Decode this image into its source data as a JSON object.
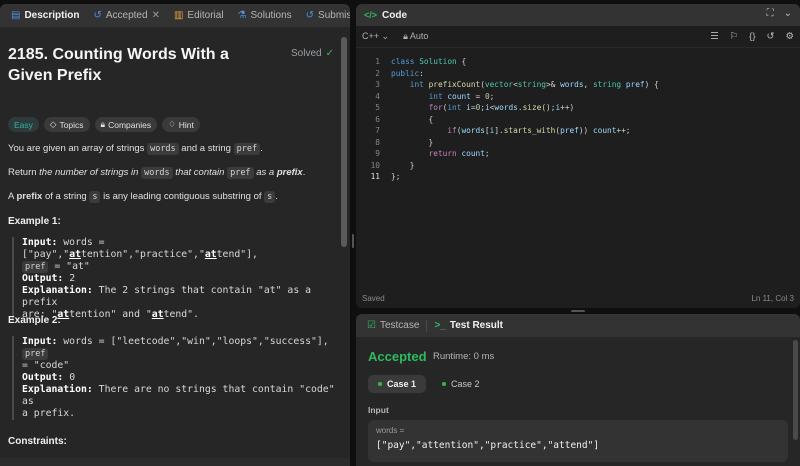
{
  "left_tabs": [
    {
      "label": "Description",
      "icon": "document-icon"
    },
    {
      "label": "Accepted",
      "icon": "history-icon"
    },
    {
      "label": "Editorial",
      "icon": "book-icon"
    },
    {
      "label": "Solutions",
      "icon": "flask-icon"
    },
    {
      "label": "Submissions",
      "icon": "history-icon"
    }
  ],
  "problem": {
    "title": "2185. Counting Words With a Given Prefix",
    "solved_label": "Solved",
    "tags": [
      "Easy",
      "Topics",
      "Companies",
      "Hint"
    ],
    "p1_a": "You are given an array of strings ",
    "p1_code1": "words",
    "p1_b": " and a string ",
    "p1_code2": "pref",
    "p1_c": ".",
    "p2_a": "Return ",
    "p2_it1": "the number of strings in ",
    "p2_code1": "words",
    "p2_it2": " that contain ",
    "p2_code2": "pref",
    "p2_it3": " as a ",
    "p2_bold": "prefix",
    "p2_c": ".",
    "p3_a": "A ",
    "p3_bold": "prefix",
    "p3_b": " of a string ",
    "p3_code": "s",
    "p3_c": " is any leading contiguous substring of ",
    "p3_code2": "s",
    "p3_d": "."
  },
  "example1": {
    "heading": "Example 1:",
    "input_label": "Input:",
    "input_a": " words = [\"pay\",\"",
    "input_ul1": "at",
    "input_b": "tention\",\"practice\",\"",
    "input_ul2": "at",
    "input_c": "tend\"],",
    "input_pref": "pref",
    "input_d": " = \"at\"",
    "output_label": "Output:",
    "output": " 2",
    "expl_label": "Explanation:",
    "expl_a": " The 2 strings that contain \"at\" as a prefix",
    "expl_b": "are: \"",
    "expl_ul1": "at",
    "expl_c": "tention\" and \"",
    "expl_ul2": "at",
    "expl_d": "tend\"."
  },
  "example2": {
    "heading": "Example 2:",
    "input_label": "Input:",
    "input_a": " words = [\"leetcode\",\"win\",\"loops\",\"success\"],",
    "input_pref": "pref",
    "input_b": "= \"code\"",
    "output_label": "Output:",
    "output": " 0",
    "expl_label": "Explanation:",
    "expl_a": " There are no strings that contain \"code\" as",
    "expl_b": "a prefix."
  },
  "constraints_heading": "Constraints:",
  "code_panel": {
    "title": "Code",
    "language": "C++",
    "mode": "Auto",
    "status_left": "Saved",
    "status_right": "Ln 11, Col 3"
  },
  "code_lines": [
    "class Solution {",
    "public:",
    "    int prefixCount(vector<string>& words, string pref) {",
    "        int count = 0;",
    "        for(int i=0;i<words.size();i++)",
    "        {",
    "            if(words[i].starts_with(pref)) count++;",
    "        }",
    "        return count;",
    "    }",
    "};"
  ],
  "result_panel": {
    "tabs": [
      "Testcase",
      "Test Result"
    ],
    "status": "Accepted",
    "runtime": "Runtime: 0 ms",
    "cases": [
      "Case 1",
      "Case 2"
    ],
    "input_label": "Input",
    "var_name": "words =",
    "var_value": "[\"pay\",\"attention\",\"practice\",\"attend\"]"
  },
  "colors": {
    "accent_green": "#2cbb5d",
    "easy_teal": "#2db4a7",
    "tab_blue": "#4f8fe6",
    "editorial_yellow": "#e6a23c"
  }
}
